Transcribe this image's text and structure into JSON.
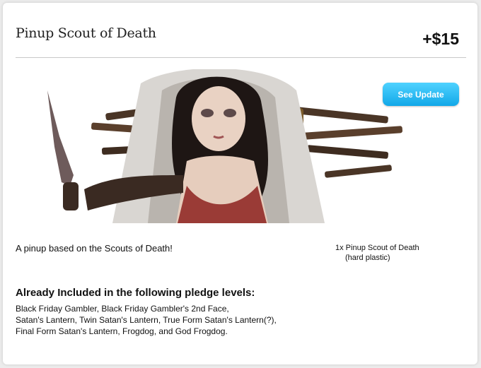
{
  "reward": {
    "title": "Pinup Scout of Death",
    "price": "+$15",
    "update_button": "See Update",
    "description": "A pinup based on the Scouts of Death!",
    "contents": [
      "1x Pinup Scout of Death",
      "(hard plastic)"
    ]
  },
  "pledge_levels": {
    "heading": "Already Included in the following pledge levels:",
    "lines": [
      "Black Friday Gambler, Black Friday Gambler's 2nd Face,",
      "Satan's Lantern, Twin Satan's Lantern, True Form Satan's Lantern(?),",
      "Final Form Satan's Lantern, Frogdog, and God Frogdog."
    ]
  },
  "colors": {
    "button_top": "#4fd2ff",
    "button_bottom": "#12a8e8",
    "divider": "#c9c9c9"
  }
}
